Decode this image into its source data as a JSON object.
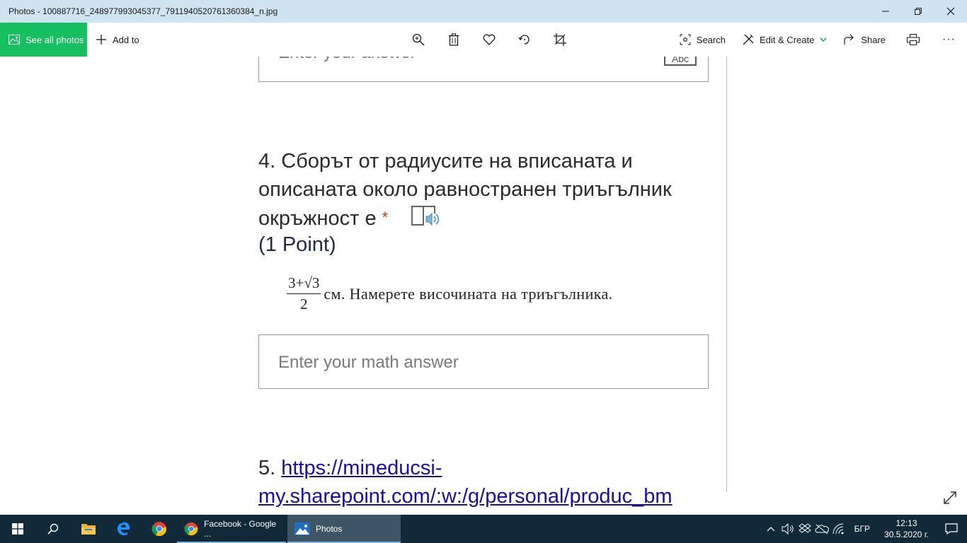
{
  "window": {
    "title": "Photos - 100887716_248977993045377_7911940520761360384_n.jpg"
  },
  "toolbar": {
    "see_all": "See all photos",
    "add_to": "Add to",
    "search": "Search",
    "edit_create": "Edit & Create",
    "share": "Share",
    "more": "···"
  },
  "image": {
    "top_field_placeholder": "Enter your answer",
    "top_field_badge": "Abc",
    "question_number": "4.",
    "question_text": "Сборът от радиусите на вписаната и описаната около равностранен триъгълник окръжност е",
    "required_mark": "*",
    "points": "(1 Point)",
    "formula_numerator": "3+√3",
    "formula_denominator": "2",
    "formula_rest": "см.  Намерете височината на триъгълника.",
    "math_field_placeholder": "Enter your math answer",
    "q5_number": "5.",
    "q5_link": "https://mineducsi-",
    "q5_link_line2": "my.sharepoint.com/:w:/g/personal/produc_bm"
  },
  "taskbar": {
    "task_facebook": "Facebook - Google ...",
    "task_photos": "Photos",
    "language": "БГР",
    "time": "12:13",
    "date": "30.5.2020 г."
  },
  "colors": {
    "title_bar": "#cfe3f1",
    "see_all_green": "#16c060",
    "taskbar": "#102a3a",
    "link": "#1a0dab",
    "required": "#c0392b"
  }
}
